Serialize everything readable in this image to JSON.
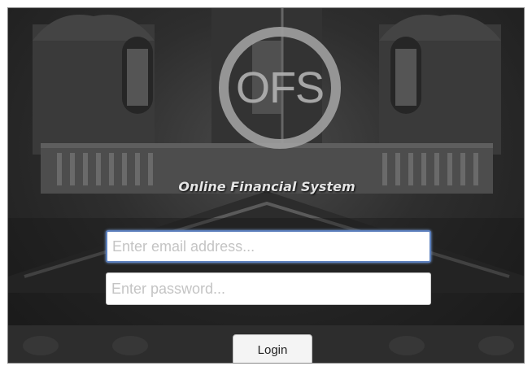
{
  "logo": {
    "text": "OFS"
  },
  "system_title": "Online Financial System",
  "login_form": {
    "email_placeholder": "Enter email address...",
    "password_placeholder": "Enter password...",
    "login_label": "Login"
  }
}
